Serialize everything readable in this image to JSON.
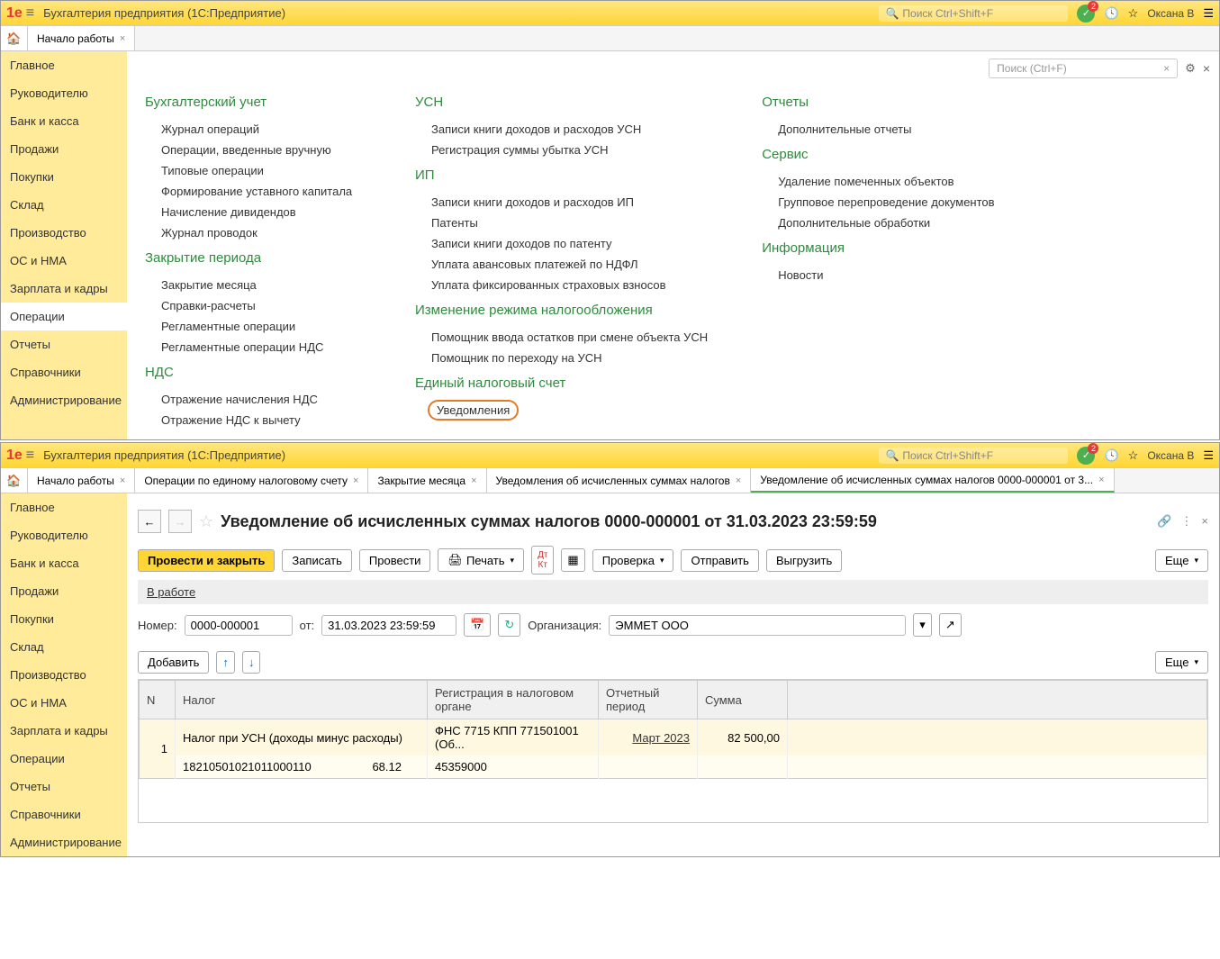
{
  "app_title": "Бухгалтерия предприятия  (1С:Предприятие)",
  "search_placeholder": "Поиск Ctrl+Shift+F",
  "notif_count": "2",
  "user": "Оксана В",
  "tabs1": [
    {
      "label": "Начало работы"
    }
  ],
  "sidebar": {
    "items": [
      "Главное",
      "Руководителю",
      "Банк и касса",
      "Продажи",
      "Покупки",
      "Склад",
      "Производство",
      "ОС и НМА",
      "Зарплата и кадры",
      "Операции",
      "Отчеты",
      "Справочники",
      "Администрирование"
    ],
    "active1": 9
  },
  "local_search": "Поиск (Ctrl+F)",
  "menu": {
    "col1": [
      {
        "title": "Бухгалтерский учет",
        "items": [
          "Журнал операций",
          "Операции, введенные вручную",
          "Типовые операции",
          "Формирование уставного капитала",
          "Начисление дивидендов",
          "Журнал проводок"
        ]
      },
      {
        "title": "Закрытие периода",
        "items": [
          "Закрытие месяца",
          "Справки-расчеты",
          "Регламентные операции",
          "Регламентные операции НДС"
        ]
      },
      {
        "title": "НДС",
        "items": [
          "Отражение начисления НДС",
          "Отражение НДС к вычету"
        ]
      }
    ],
    "col2": [
      {
        "title": "УСН",
        "items": [
          "Записи книги доходов и расходов УСН",
          "Регистрация суммы убытка УСН"
        ]
      },
      {
        "title": "ИП",
        "items": [
          "Записи книги доходов и расходов ИП",
          "Патенты",
          "Записи книги доходов по патенту",
          "Уплата авансовых платежей по НДФЛ",
          "Уплата фиксированных страховых взносов"
        ]
      },
      {
        "title": "Изменение режима налогообложения",
        "items": [
          "Помощник ввода остатков при смене объекта УСН",
          "Помощник по переходу на УСН"
        ]
      },
      {
        "title": "Единый налоговый счет",
        "items": [
          "Уведомления"
        ]
      }
    ],
    "col3": [
      {
        "title": "Отчеты",
        "items": [
          "Дополнительные отчеты"
        ]
      },
      {
        "title": "Сервис",
        "items": [
          "Удаление помеченных объектов",
          "Групповое перепроведение документов",
          "Дополнительные обработки"
        ]
      },
      {
        "title": "Информация",
        "items": [
          "Новости"
        ]
      }
    ]
  },
  "tabs2": [
    {
      "label": "Начало работы"
    },
    {
      "label": "Операции по единому налоговому счету"
    },
    {
      "label": "Закрытие месяца"
    },
    {
      "label": "Уведомления об исчисленных суммах налогов"
    },
    {
      "label": "Уведомление об исчисленных суммах налогов 0000-000001 от 3...",
      "active": true
    }
  ],
  "doc": {
    "title": "Уведомление об исчисленных суммах налогов 0000-000001 от 31.03.2023 23:59:59",
    "status": "В работе",
    "buttons": {
      "post_close": "Провести и закрыть",
      "save": "Записать",
      "post": "Провести",
      "print": "Печать",
      "check": "Проверка",
      "send": "Отправить",
      "export": "Выгрузить",
      "more": "Еще"
    },
    "fields": {
      "number_label": "Номер:",
      "number": "0000-000001",
      "date_label": "от:",
      "date": "31.03.2023 23:59:59",
      "org_label": "Организация:",
      "org": "ЭММЕТ ООО"
    },
    "table_toolbar": {
      "add": "Добавить",
      "more": "Еще"
    },
    "table": {
      "headers": [
        "N",
        "Налог",
        "Регистрация в налоговом органе",
        "Отчетный период",
        "Сумма",
        ""
      ],
      "rows": [
        {
          "n": "1",
          "tax": "Налог при УСН (доходы минус расходы)",
          "reg": "ФНС 7715 КПП 771501001 (Об...",
          "period": "Март 2023",
          "sum": "82 500,00",
          "code1": "18210501021011000110",
          "code2": "68.12",
          "code3": "45359000"
        }
      ]
    }
  }
}
